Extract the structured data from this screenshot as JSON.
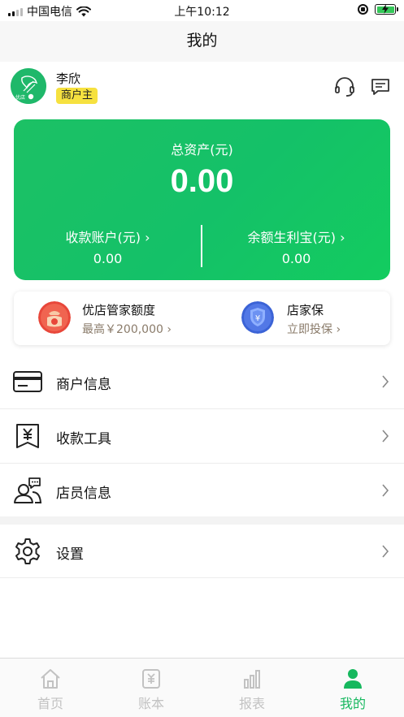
{
  "status_bar": {
    "carrier": "中国电信",
    "time": "上午10:12"
  },
  "nav": {
    "title": "我的"
  },
  "profile": {
    "name": "李欣",
    "role": "商户主"
  },
  "assets": {
    "total_label": "总资产(元)",
    "total_value": "0.00",
    "receive_account_label": "收款账户(元) ›",
    "receive_account_value": "0.00",
    "balance_label": "余额生利宝(元) ›",
    "balance_value": "0.00"
  },
  "services": [
    {
      "title": "优店管家额度",
      "subtitle": "最高￥200,000 ›"
    },
    {
      "title": "店家保",
      "subtitle": "立即投保 ›"
    }
  ],
  "menu": [
    {
      "label": "商户信息"
    },
    {
      "label": "收款工具"
    },
    {
      "label": "店员信息"
    },
    {
      "label": "设置"
    }
  ],
  "tabs": [
    {
      "label": "首页"
    },
    {
      "label": "账本"
    },
    {
      "label": "报表"
    },
    {
      "label": "我的"
    }
  ],
  "colors": {
    "brand_green": "#16b85e",
    "badge_yellow": "#f6e13f"
  }
}
